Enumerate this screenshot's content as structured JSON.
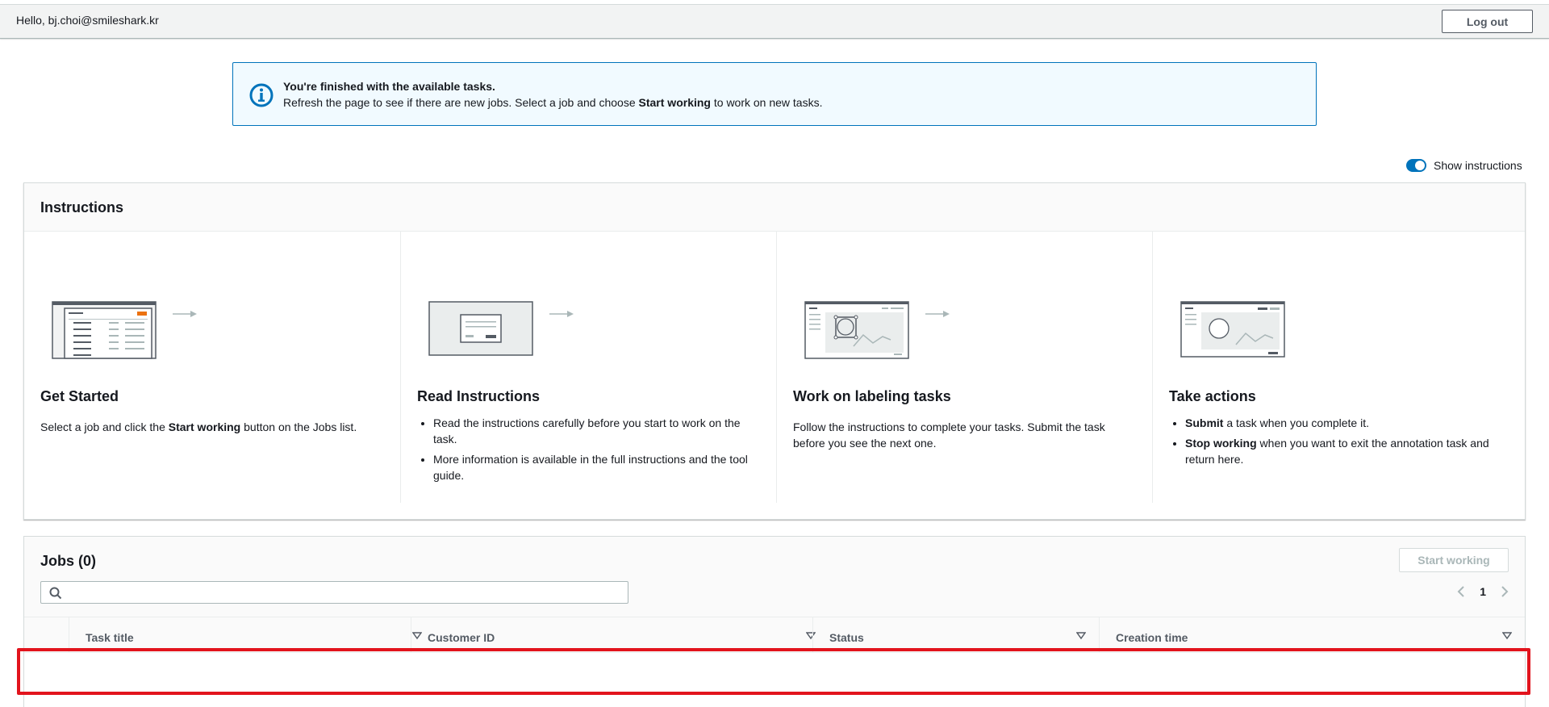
{
  "header": {
    "greeting": "Hello, bj.choi@smileshark.kr",
    "logout_label": "Log out"
  },
  "flash": {
    "title": "You're finished with the available tasks.",
    "text_before": "Refresh the page to see if there are new jobs. Select a job and choose ",
    "text_bold": "Start working",
    "text_after": " to work on new tasks.",
    "icon": "info-icon"
  },
  "toggle": {
    "label": "Show instructions",
    "on": true
  },
  "instructions": {
    "title": "Instructions",
    "steps": [
      {
        "title": "Get Started",
        "text_before": "Select a job and click the ",
        "text_bold": "Start working",
        "text_after": " button on the Jobs list."
      },
      {
        "title": "Read Instructions",
        "bullets": [
          "Read the instructions carefully before you start to work on the task.",
          "More information is available in the full instructions and the tool guide."
        ]
      },
      {
        "title": "Work on labeling tasks",
        "text": "Follow the instructions to complete your tasks. Submit the task before you see the next one."
      },
      {
        "title": "Take actions",
        "bullet1_bold": "Submit",
        "bullet1_rest": " a task when you complete it.",
        "bullet2_bold": "Stop working",
        "bullet2_rest": " when you want to exit the annotation task and return here."
      }
    ]
  },
  "jobs": {
    "title": "Jobs (0)",
    "start_label": "Start working",
    "search_placeholder": "",
    "page": "1",
    "columns": [
      "Task title",
      "Customer ID",
      "Status",
      "Creation time"
    ],
    "rows": []
  },
  "colors": {
    "accent": "#0073bb",
    "highlight": "#e2141d"
  }
}
